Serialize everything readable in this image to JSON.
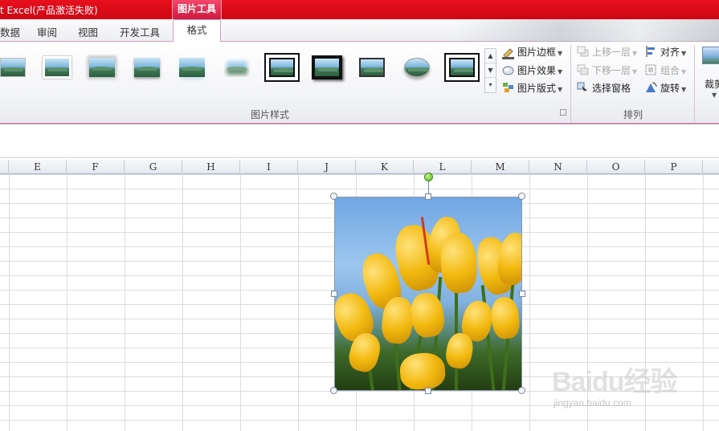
{
  "window": {
    "title": "t Excel(产品激活失败)",
    "context_tab_header": "图片工具"
  },
  "tabs": [
    {
      "label": "数据",
      "active": false
    },
    {
      "label": "审阅",
      "active": false
    },
    {
      "label": "视图",
      "active": false
    },
    {
      "label": "开发工具",
      "active": false
    },
    {
      "label": "格式",
      "active": true
    }
  ],
  "ribbon": {
    "picture_styles": {
      "group_label": "图片样式",
      "gallery_count": 11,
      "scroll_up": "▲",
      "scroll_down": "▼",
      "scroll_more": "▾",
      "picture_border": "图片边框",
      "picture_effects": "图片效果",
      "picture_layout": "图片版式"
    },
    "arrange": {
      "group_label": "排列",
      "bring_forward": "上移一层",
      "send_backward": "下移一层",
      "selection_pane": "选择窗格",
      "align": "对齐",
      "group": "组合",
      "rotate": "旋转"
    },
    "size": {
      "crop": "裁剪"
    }
  },
  "sheet": {
    "columns": [
      "E",
      "F",
      "G",
      "H",
      "I",
      "J",
      "K",
      "L",
      "M",
      "N",
      "O",
      "P"
    ]
  },
  "watermark": {
    "main": "Baidu经验",
    "sub": "jingyan.baidu.com"
  },
  "colors": {
    "title_bar": "#e8101e",
    "context_tab": "#d01a40",
    "ribbon_accent": "#c78fb2"
  }
}
